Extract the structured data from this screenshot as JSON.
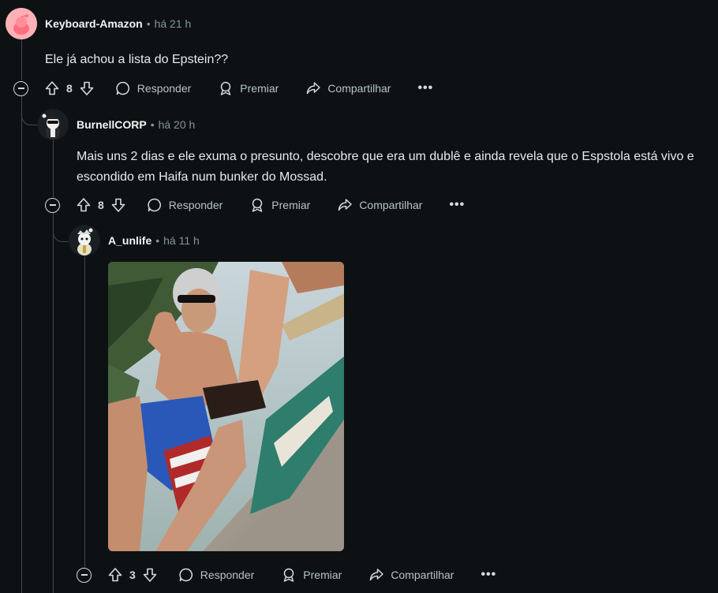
{
  "comments": [
    {
      "author": "Keyboard-Amazon",
      "time": "há 21 h",
      "body": "Ele já achou a lista do Epstein??",
      "score": "8"
    },
    {
      "author": "BurnellCORP",
      "time": "há 20 h",
      "body": "Mais uns 2 dias e ele exuma o presunto, descobre que era um dublê e ainda revela que o Espstola está vivo e escondido em Haifa num bunker do Mossad.",
      "score": "8"
    },
    {
      "author": "A_unlife",
      "time": "há 11 h",
      "score": "3",
      "media": "photo"
    }
  ],
  "actions": {
    "reply": "Responder",
    "award": "Premiar",
    "share": "Compartilhar",
    "more": "•••"
  },
  "separator": "•",
  "icons": [
    "collapse-icon",
    "upvote-icon",
    "downvote-icon",
    "reply-icon",
    "award-icon",
    "share-icon",
    "more-icon"
  ],
  "colors": {
    "background": "#0e1113",
    "text": "#f2f4f5",
    "meta": "#82959b",
    "action": "#b7c4c9",
    "thread_line": "#3e4a52",
    "avatar1": "#ffb0b7"
  }
}
